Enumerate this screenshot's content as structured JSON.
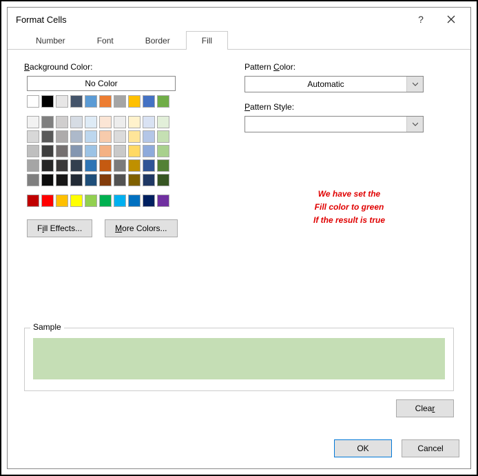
{
  "title": "Format Cells",
  "tabs": [
    "Number",
    "Font",
    "Border",
    "Fill"
  ],
  "active_tab": "Fill",
  "background_color_label": "Background Color:",
  "no_color_label": "No Color",
  "fill_effects_label": "Fill Effects...",
  "more_colors_label": "More Colors...",
  "pattern_color_label": "Pattern Color:",
  "pattern_color_value": "Automatic",
  "pattern_style_label": "Pattern Style:",
  "pattern_style_value": "",
  "annotation_line1": "We have set the",
  "annotation_line2": "Fill color to green",
  "annotation_line3": "If the result is true",
  "sample_label": "Sample",
  "sample_color": "#c5deb5",
  "clear_label": "Clear",
  "ok_label": "OK",
  "cancel_label": "Cancel",
  "swatches_row1": [
    "#ffffff",
    "#000000",
    "#e7e6e6",
    "#44546a",
    "#5b9bd5",
    "#ed7d31",
    "#a5a5a5",
    "#ffc000",
    "#4472c4",
    "#70ad47"
  ],
  "swatches_theme": [
    "#f2f2f2",
    "#7f7f7f",
    "#d0cece",
    "#d6dce4",
    "#deebf6",
    "#fbe5d5",
    "#ededed",
    "#fff2cc",
    "#d9e2f3",
    "#e2efd9",
    "#d8d8d8",
    "#595959",
    "#aeabab",
    "#adb9ca",
    "#bdd7ee",
    "#f7cbac",
    "#dbdbdb",
    "#fee599",
    "#b4c6e7",
    "#c5e0b3",
    "#bfbfbf",
    "#3f3f3f",
    "#757070",
    "#8496b0",
    "#9cc3e5",
    "#f4b183",
    "#c9c9c9",
    "#ffd965",
    "#8eaadb",
    "#a8d08d",
    "#a5a5a5",
    "#262626",
    "#3a3838",
    "#323f4f",
    "#2e75b5",
    "#c55a11",
    "#7b7b7b",
    "#bf9000",
    "#2f5496",
    "#538135",
    "#7f7f7f",
    "#0c0c0c",
    "#171616",
    "#222a35",
    "#1e4e79",
    "#833c0b",
    "#525252",
    "#7f6000",
    "#1f3864",
    "#375623"
  ],
  "swatches_standard": [
    "#c00000",
    "#ff0000",
    "#ffc000",
    "#ffff00",
    "#92d050",
    "#00b050",
    "#00b0f0",
    "#0070c0",
    "#002060",
    "#7030a0"
  ]
}
